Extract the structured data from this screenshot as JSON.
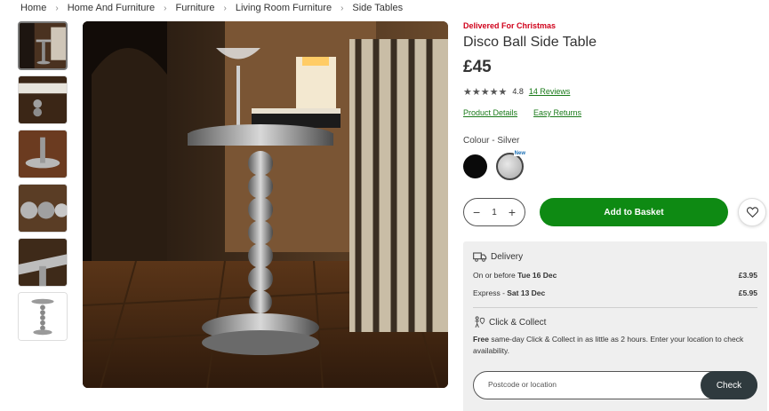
{
  "breadcrumb": [
    "Home",
    "Home And Furniture",
    "Furniture",
    "Living Room Furniture",
    "Side Tables"
  ],
  "product": {
    "promo": "Delivered For Christmas",
    "title": "Disco Ball Side Table",
    "price": "£45",
    "stars": "★★★★★",
    "rating": "4.8",
    "reviews_link": "14 Reviews",
    "details_link": "Product Details",
    "returns_link": "Easy Returns",
    "colour_label": "Colour - Silver",
    "swatches": [
      {
        "name": "black",
        "color": "#0a0a0a",
        "selected": false
      },
      {
        "name": "silver",
        "color": "#b0b0b0",
        "selected": true,
        "badge": "New"
      }
    ]
  },
  "buy": {
    "qty_minus": "−",
    "qty_value": "1",
    "qty_plus": "+",
    "add_label": "Add to Basket",
    "wishlist_icon": "heart-icon"
  },
  "delivery": {
    "title": "Delivery",
    "icon": "truck-icon",
    "rows": [
      {
        "prefix": "On or before ",
        "date": "Tue 16 Dec",
        "price": "£3.95"
      },
      {
        "prefix": "Express - ",
        "date": "Sat 13 Dec",
        "price": "£5.95"
      }
    ]
  },
  "collect": {
    "title": "Click & Collect",
    "icon": "person-pin-icon",
    "bold": "Free",
    "text": " same-day Click & Collect in as little as 2 hours. Enter your location to check availability.",
    "placeholder": "Postcode or location",
    "check_label": "Check"
  },
  "colors": {
    "accent_green": "#0e8a13",
    "promo_red": "#d0021b",
    "link_green": "#1a7a1a",
    "check_dark": "#2f3a3e"
  }
}
